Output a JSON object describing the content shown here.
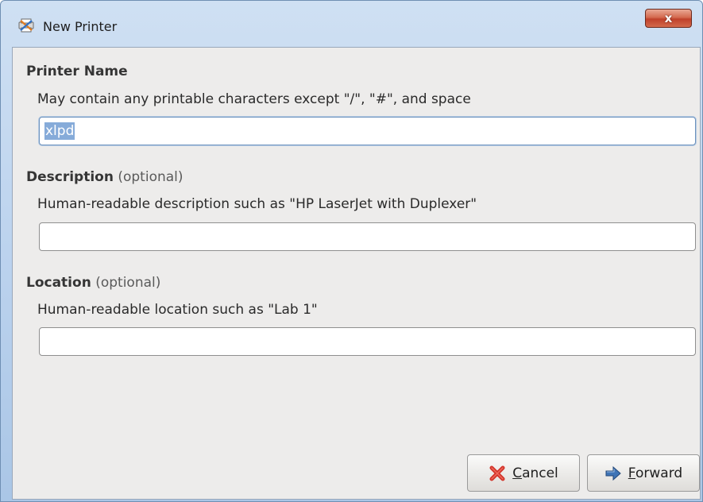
{
  "window": {
    "title": "New Printer",
    "close_label": "x"
  },
  "printer_name": {
    "title": "Printer Name",
    "hint": "May contain any printable characters except \"/\", \"#\", and space",
    "value": "xlpd"
  },
  "description": {
    "title": "Description",
    "optional": "(optional)",
    "hint": "Human-readable description such as \"HP LaserJet with Duplexer\"",
    "value": ""
  },
  "location": {
    "title": "Location",
    "optional": "(optional)",
    "hint": "Human-readable location such as \"Lab 1\"",
    "value": ""
  },
  "buttons": {
    "cancel_mnemonic": "C",
    "cancel_rest": "ancel",
    "forward_mnemonic": "F",
    "forward_rest": "orward"
  },
  "icons": {
    "app": "printer-app-icon",
    "cancel": "red-x-icon",
    "forward": "right-arrow-icon"
  },
  "colors": {
    "titlebar": "#bcd3ee",
    "close_button": "#c0412b",
    "client_background": "#edeceb",
    "selection": "#86abd9",
    "cancel_icon": "#d2342a",
    "forward_icon": "#3f74b6"
  }
}
